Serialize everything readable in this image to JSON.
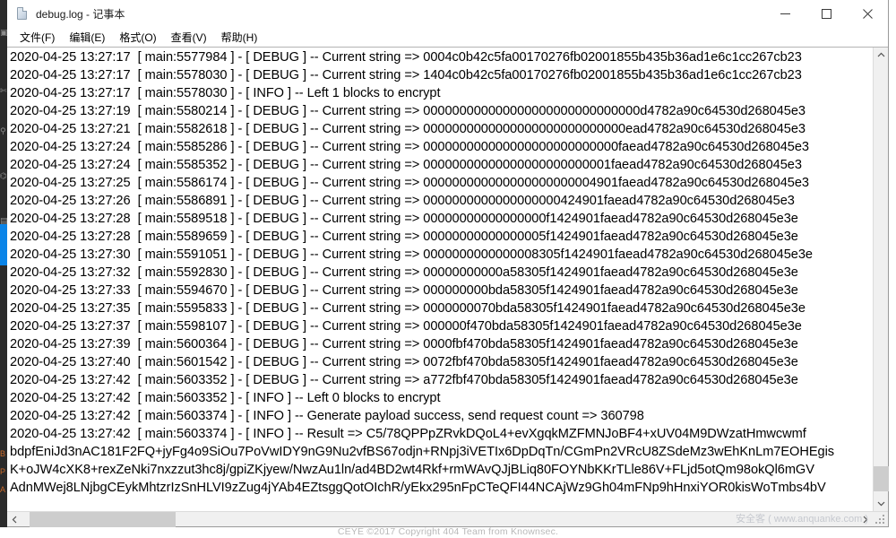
{
  "window": {
    "title": "debug.log - 记事本",
    "icon": "notepad-document-icon",
    "buttons": {
      "minimize": "minimize-icon",
      "maximize": "maximize-icon",
      "close": "close-icon"
    }
  },
  "menu": {
    "items": [
      {
        "label": "文件(F)",
        "text": "文件(",
        "accel": "F",
        "tail": ")"
      },
      {
        "label": "编辑(E)",
        "text": "编辑(",
        "accel": "E",
        "tail": ")"
      },
      {
        "label": "格式(O)",
        "text": "格式(",
        "accel": "O",
        "tail": ")"
      },
      {
        "label": "查看(V)",
        "text": "查看(",
        "accel": "V",
        "tail": ")"
      },
      {
        "label": "帮助(H)",
        "text": "帮助(",
        "accel": "H",
        "tail": ")"
      }
    ]
  },
  "editor": {
    "lines": [
      "2020-04-25 13:27:17  [ main:5577984 ] - [ DEBUG ] -- Current string => 0004c0b42c5fa00170276fb02001855b435b36ad1e6c1cc267cb23",
      "2020-04-25 13:27:17  [ main:5578030 ] - [ DEBUG ] -- Current string => 1404c0b42c5fa00170276fb02001855b435b36ad1e6c1cc267cb23",
      "2020-04-25 13:27:17  [ main:5578030 ] - [ INFO ] -- Left 1 blocks to encrypt",
      "2020-04-25 13:27:19  [ main:5580214 ] - [ DEBUG ] -- Current string => 000000000000000000000000000000d4782a90c64530d268045e3",
      "2020-04-25 13:27:21  [ main:5582618 ] - [ DEBUG ] -- Current string => 0000000000000000000000000000ead4782a90c64530d268045e3",
      "2020-04-25 13:27:24  [ main:5585286 ] - [ DEBUG ] -- Current string => 000000000000000000000000000faead4782a90c64530d268045e3",
      "2020-04-25 13:27:24  [ main:5585352 ] - [ DEBUG ] -- Current string => 00000000000000000000000001faead4782a90c64530d268045e3",
      "2020-04-25 13:27:25  [ main:5586174 ] - [ DEBUG ] -- Current string => 000000000000000000000004901faead4782a90c64530d268045e3",
      "2020-04-25 13:27:26  [ main:5586891 ] - [ DEBUG ] -- Current string => 0000000000000000000424901faead4782a90c64530d268045e3",
      "2020-04-25 13:27:28  [ main:5589518 ] - [ DEBUG ] -- Current string => 00000000000000000f1424901faead4782a90c64530d268045e3e",
      "2020-04-25 13:27:28  [ main:5589659 ] - [ DEBUG ] -- Current string => 00000000000000005f1424901faead4782a90c64530d268045e3e",
      "2020-04-25 13:27:30  [ main:5591051 ] - [ DEBUG ] -- Current string => 0000000000000008305f1424901faead4782a90c64530d268045e3e",
      "2020-04-25 13:27:32  [ main:5592830 ] - [ DEBUG ] -- Current string => 00000000000a58305f1424901faead4782a90c64530d268045e3e",
      "2020-04-25 13:27:33  [ main:5594670 ] - [ DEBUG ] -- Current string => 000000000bda58305f1424901faead4782a90c64530d268045e3e",
      "2020-04-25 13:27:35  [ main:5595833 ] - [ DEBUG ] -- Current string => 0000000070bda58305f1424901faead4782a90c64530d268045e3e",
      "2020-04-25 13:27:37  [ main:5598107 ] - [ DEBUG ] -- Current string => 000000f470bda58305f1424901faead4782a90c64530d268045e3e",
      "2020-04-25 13:27:39  [ main:5600364 ] - [ DEBUG ] -- Current string => 0000fbf470bda58305f1424901faead4782a90c64530d268045e3e",
      "2020-04-25 13:27:40  [ main:5601542 ] - [ DEBUG ] -- Current string => 0072fbf470bda58305f1424901faead4782a90c64530d268045e3e",
      "2020-04-25 13:27:42  [ main:5603352 ] - [ DEBUG ] -- Current string => a772fbf470bda58305f1424901faead4782a90c64530d268045e3e",
      "2020-04-25 13:27:42  [ main:5603352 ] - [ INFO ] -- Left 0 blocks to encrypt",
      "2020-04-25 13:27:42  [ main:5603374 ] - [ INFO ] -- Generate payload success, send request count => 360798",
      "2020-04-25 13:27:42  [ main:5603374 ] - [ INFO ] -- Result => C5/78QPPpZRvkDQoL4+evXgqkMZFMNJoBF4+xUV04M9DWzatHmwcwmf",
      "bdpfEniJd3nAC181F2FQ+jyFg4o9SiOu7PoVwIDY9nG9Nu2vfBS67odjn+RNpj3iVETIx6DpDqTn/CGmPn2VRcU8ZSdeMz3wEhKnLm7EOHEgis",
      "K+oJW4cXK8+rexZeNki7nxzzut3hc8j/gpiZKjyew/NwzAu1ln/ad4BD2wt4Rkf+rmWAvQJjBLiq80FOYNbKKrTLle86V+FLjd5otQm98okQl6mGV",
      "AdnMWej8LNjbgCEykMhtzrIzSnHLVI9zZug4jYAb4EZtsggQotOIchR/yEkx295nFpCTeQFI44NCAjWz9Gh04mFNp9hHnxiYOR0kisWoTmbs4bV"
    ]
  },
  "scrollbars": {
    "vertical": {
      "up_arrow": "chevron-up-icon",
      "down_arrow": "chevron-down-icon"
    },
    "horizontal": {
      "left_arrow": "chevron-left-icon",
      "right_arrow": "chevron-right-icon"
    }
  },
  "watermarks": {
    "site": "安全客 ( www.anquanke.com )",
    "footer": "CEYE ©2017 Copyright 404 Team from Knownsec."
  },
  "taskbar": {
    "icons": [
      "window-icon",
      "scissors-icon",
      "key-icon",
      "bug-icon",
      "editor-icon"
    ],
    "bottom_icons": [
      "b-icon",
      "p-icon",
      "a-icon"
    ]
  }
}
